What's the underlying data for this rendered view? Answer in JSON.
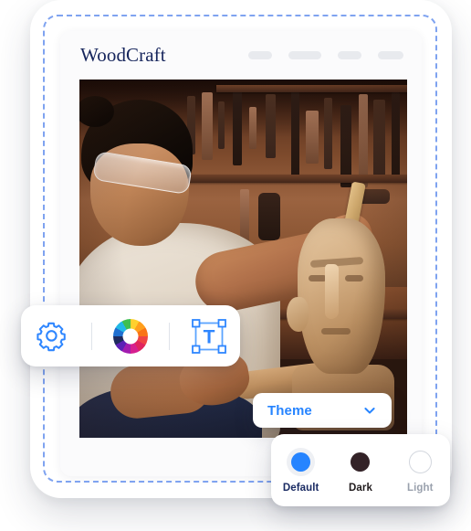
{
  "app": {
    "brand_title": "WoodCraft",
    "header_placeholder_pills": [
      26,
      36,
      26,
      28
    ]
  },
  "photo": {
    "alt": "Woodcarver in safety goggles carving a wooden head sculpture in a workshop",
    "subject": "wood carver",
    "background": "workshop pegboard wall with hand tools"
  },
  "toolbar": {
    "items": [
      {
        "name": "settings-icon",
        "label": "Settings"
      },
      {
        "name": "color-wheel-icon",
        "label": "Colors"
      },
      {
        "name": "text-tool-icon",
        "label": "Text",
        "glyph": "T"
      }
    ]
  },
  "theme_dropdown": {
    "label": "Theme",
    "chevron": "chevron-down-icon",
    "accent_color": "#2684ff"
  },
  "theme_panel": {
    "selected": "Default",
    "options": [
      {
        "label": "Default",
        "color": "#2684ff",
        "selected": true
      },
      {
        "label": "Dark",
        "color": "#332227",
        "selected": false
      },
      {
        "label": "Light",
        "color": "#ffffff",
        "selected": false
      }
    ]
  },
  "selection": {
    "border_color": "#7fa3f0",
    "style": "dashed"
  },
  "colors": {
    "accent": "#2684ff",
    "title": "#16255c",
    "card_bg": "#fbfbfc",
    "pill": "#e8eaee"
  }
}
